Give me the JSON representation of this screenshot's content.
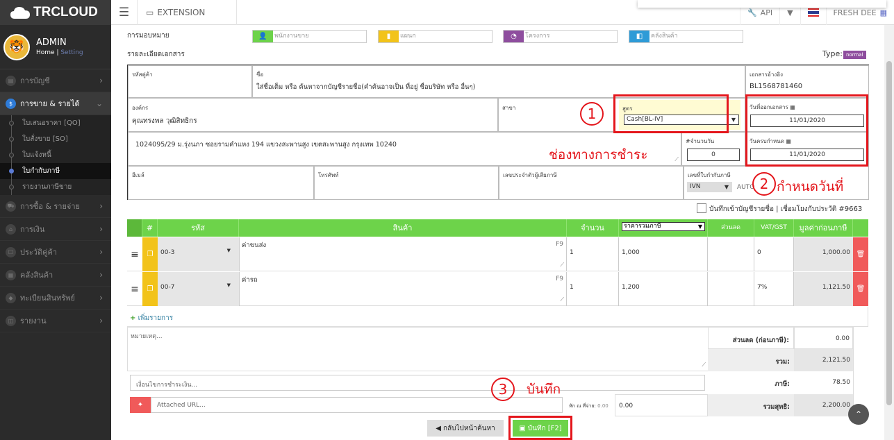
{
  "app": {
    "name": "TRCLOUD"
  },
  "user": {
    "name": "ADMIN",
    "home": "Home",
    "setting": "Setting"
  },
  "topbar": {
    "extension": "EXTENSION",
    "api": "API",
    "company": "FRESH DEE"
  },
  "menu": [
    {
      "label": "การบัญชี"
    },
    {
      "label": "การขาย & รายได้",
      "active": true,
      "sub": [
        "ใบเสนอราคา [QO]",
        "ใบสั่งขาย [SO]",
        "ใบแจ้งหนี้",
        "ใบกำกับภาษี",
        "รายงานภาษีขาย"
      ]
    },
    {
      "label": "การซื้อ & รายจ่าย"
    },
    {
      "label": "การเงิน"
    },
    {
      "label": "ประวัติคู่ค้า"
    },
    {
      "label": "คลังสินค้า"
    },
    {
      "label": "ทะเบียนสินทรัพย์"
    },
    {
      "label": "รายงาน"
    }
  ],
  "assign": {
    "label": "การมอบหมาย",
    "salesperson": "พนักงานขาย",
    "department": "แผนก",
    "project": "โครงการ",
    "warehouse": "คลังสินค้า"
  },
  "doc": {
    "label": "รายละเอียดเอกสาร",
    "type_label": "Type:",
    "type_value": "normal"
  },
  "form": {
    "code_label": "รหัสคู่ค้า",
    "name_label": "ชื่อ",
    "name_placeholder": "ใส่ชื่อเต็ม หรือ ค้นหาจากบัญชีรายชื่อ(คำค้นอาจเป็น ที่อยู่ ชื่อบริษัท หรือ อื่นๆ)",
    "ref_label": "เอกสารอ้างอิง",
    "ref_value": "BL1568781460",
    "org_label": "องค์กร",
    "org_value": "คุณทรงพล วุฒิสิทธิกร",
    "branch_label": "สาขา",
    "formula_label": "สูตร",
    "formula_value": "Cash[BL-IV]",
    "issue_label": "วันที่ออกเอกสาร",
    "issue_value": "11/01/2020",
    "address": "1024095/29 ม.รุ่งนภา ซอยรามคำแหง 194 แขวงสะพานสูง เขตสะพานสูง กรุงเทพ 10240",
    "days_label": "#จำนวนวัน",
    "days_value": "0",
    "due_label": "วันครบกำหนด",
    "due_value": "11/01/2020",
    "email_label": "อีเมล์",
    "phone_label": "โทรศัพท์",
    "tax_label": "เลขประจำตัวผู้เสียภาษี",
    "inv_label": "เลขที่ใบกำกับภาษี",
    "inv_value": "IVN",
    "auto": "AUTO",
    "contact_save": "บันทึกเข้าบัญชีรายชื่อ | เชื่อมโยงกับประวัติ #9663"
  },
  "annotations": {
    "a1": "1",
    "a2": "2",
    "a3": "3",
    "payment": "ช่องทางการชำระ",
    "setdate": "กำหนดวันที่",
    "save": "บันทึก"
  },
  "table": {
    "headers": {
      "num": "#",
      "code": "รหัส",
      "product": "สินค้า",
      "qty": "จำนวน",
      "price": "ราคารวมภาษี",
      "discount": "ส่วนลด",
      "vat": "VAT/GST",
      "pretax": "มูลค่าก่อนภาษี"
    },
    "rows": [
      {
        "code": "00-3",
        "desc": "ค่าขนส่ง",
        "key": "F9",
        "qty": "1",
        "price": "1,000",
        "discount": "",
        "vat": "0",
        "amount": "1,000.00"
      },
      {
        "code": "00-7",
        "desc": "ค่ารถ",
        "key": "F9",
        "qty": "1",
        "price": "1,200",
        "discount": "",
        "vat": "7%",
        "amount": "1,121.50"
      }
    ],
    "add": "เพิ่มรายการ"
  },
  "footer": {
    "note_placeholder": "หมายเหตุ...",
    "payterm_placeholder": "เงื่อนไขการชำระเงิน...",
    "url_placeholder": "Attached URL...",
    "discount_label": "ส่วนลด (ก่อนภาษี):",
    "discount_value": "0.00",
    "sum_label": "รวม:",
    "sum_value": "2,121.50",
    "tax_label": "ภาษี:",
    "tax_value": "78.50",
    "wht_label": "หัก ณ ที่จ่าย:",
    "wht_small": "0.00",
    "wht_value": "0.00",
    "net_label": "รวมสุทธิ:",
    "net_value": "2,200.00",
    "back_button": "กลับไปหน้าค้นหา",
    "save_button": "บันทึก [F2]"
  }
}
